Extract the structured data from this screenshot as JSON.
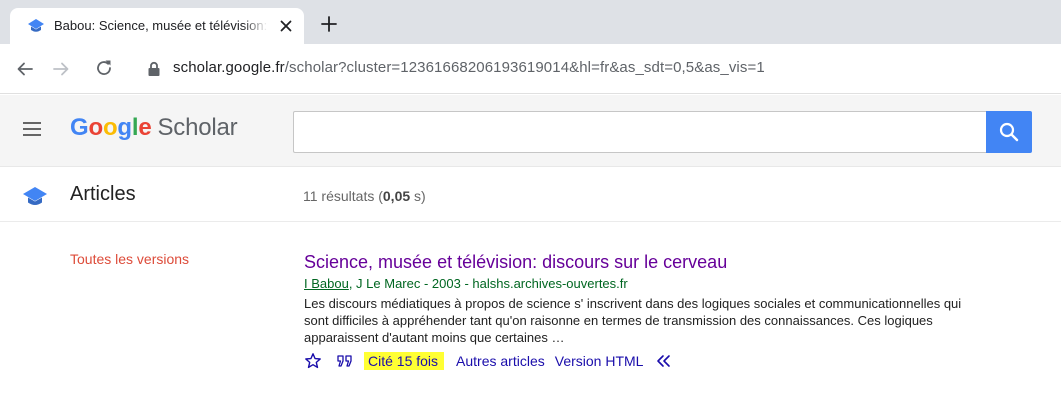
{
  "browser": {
    "tab_title": "Babou: Science, musée et télévision: discours sur le cerveau",
    "url_host": "scholar.google.fr",
    "url_path": "/scholar?cluster=12361668206193619014&hl=fr&as_sdt=0,5&as_vis=1"
  },
  "header": {
    "logo": {
      "g1": "G",
      "o1": "o",
      "o2": "o",
      "g2": "g",
      "l": "l",
      "e": "e",
      "scholar": "Scholar"
    },
    "search_value": "",
    "colors": {
      "blue": "#4285f4",
      "red": "#ea4335",
      "yellow": "#fbbc05",
      "green": "#34a853"
    }
  },
  "articles_bar": {
    "label": "Articles",
    "results_prefix": "11 résultats (",
    "results_time": "0,05",
    "results_suffix": " s)"
  },
  "sidebar": {
    "all_versions": "Toutes les versions"
  },
  "result": {
    "title": "Science, musée et télévision: discours sur le cerveau",
    "author_link": "I Babou",
    "authors_rest": ", J Le Marec - 2003 - halshs.archives-ouvertes.fr",
    "snippet": "Les discours médiatiques à propos de science s' inscrivent dans des logiques sociales et communicationnelles qui sont difficiles à appréhender tant qu'on raisonne en termes de transmission des connaissances. Ces logiques apparaissent d'autant moins que certaines …",
    "actions": {
      "cited_by": "Cité 15 fois",
      "related": "Autres articles",
      "html_version": "Version HTML"
    },
    "highlight_color": "#ffff33"
  }
}
